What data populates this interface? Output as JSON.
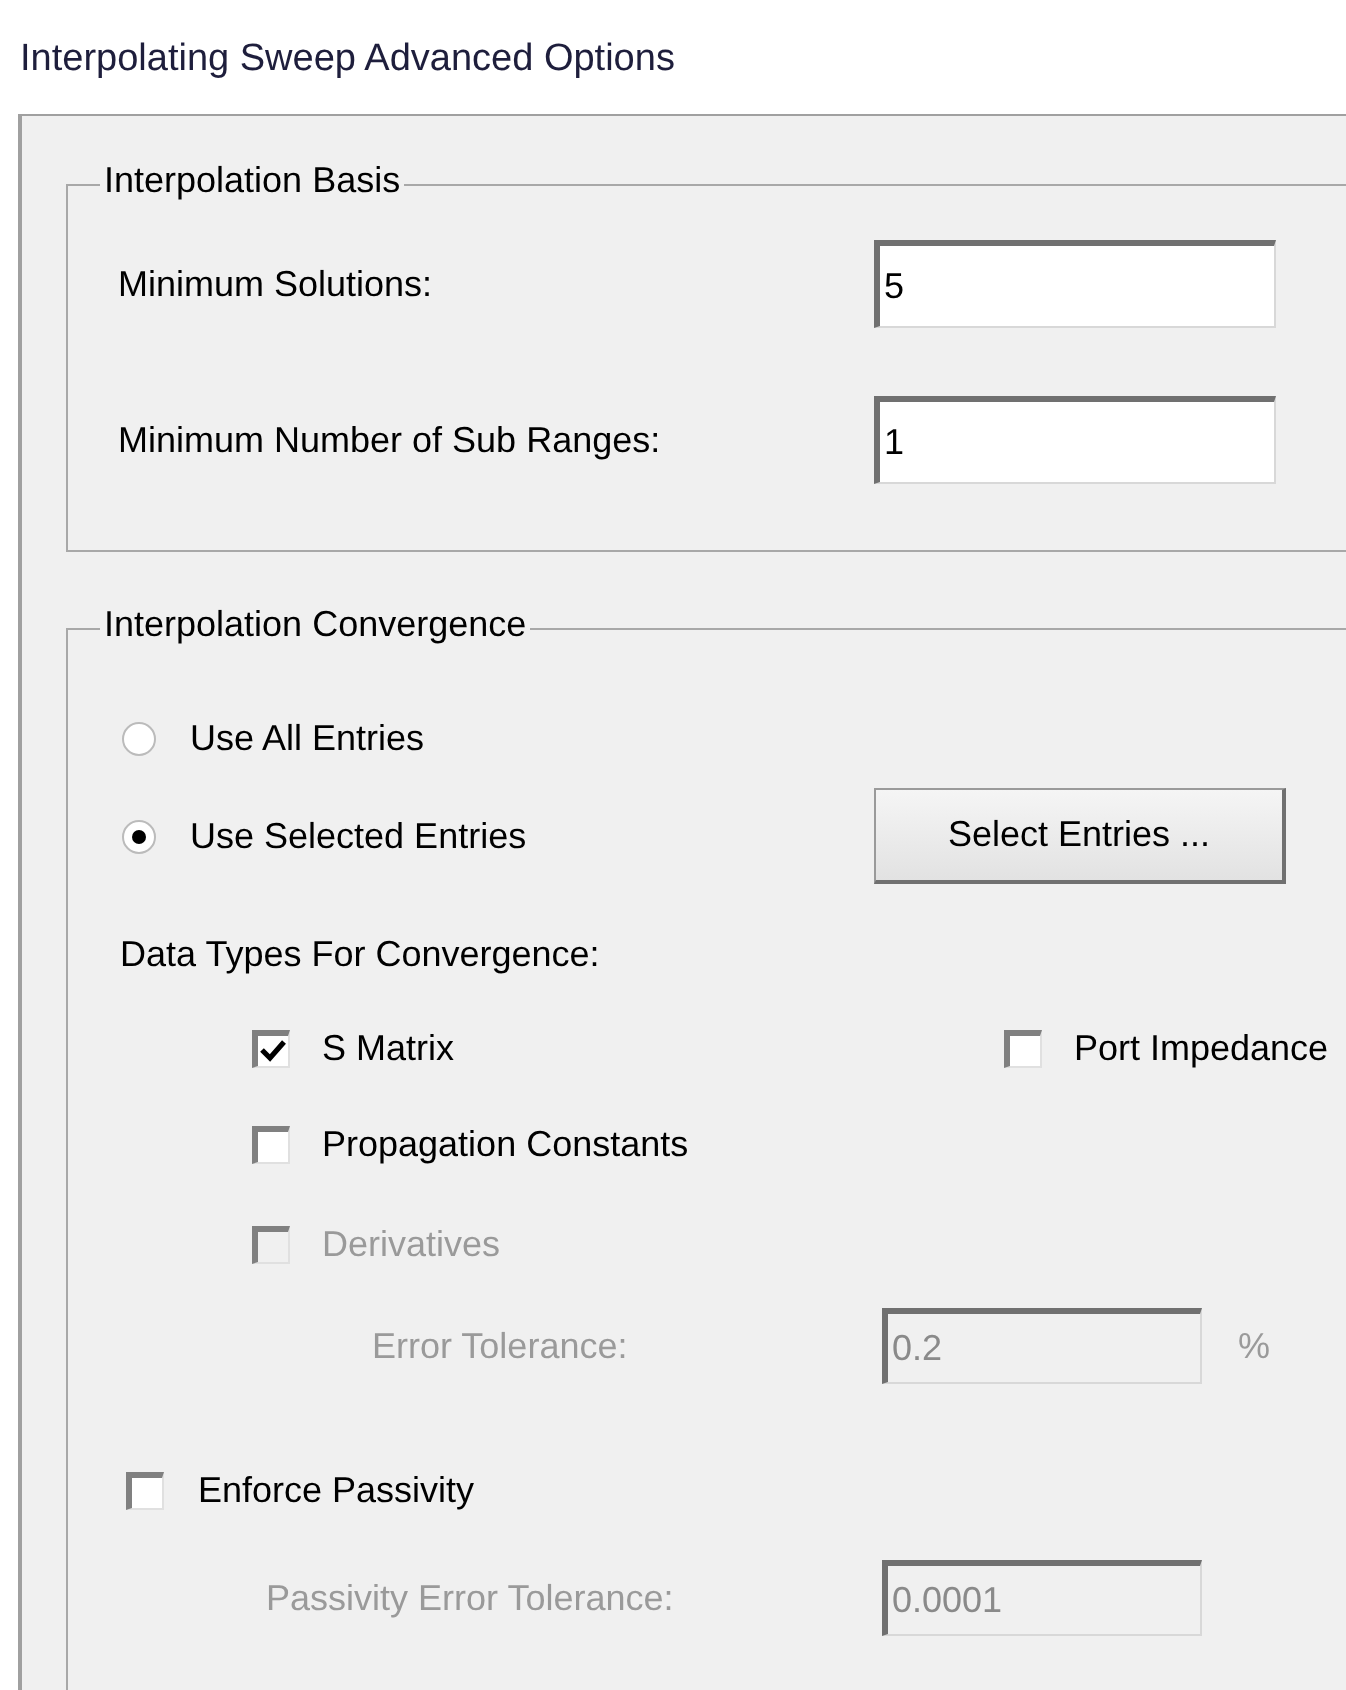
{
  "window": {
    "title": "Interpolating Sweep Advanced Options"
  },
  "interpolation_basis": {
    "title": "Interpolation Basis",
    "fields": [
      {
        "label": "Minimum Solutions:",
        "value": "5"
      },
      {
        "label": "Minimum Number of Sub Ranges:",
        "value": "1"
      }
    ]
  },
  "interpolation_convergence": {
    "title": "Interpolation Convergence",
    "entry_mode": [
      {
        "label": "Use All Entries",
        "selected": false
      },
      {
        "label": "Use Selected Entries",
        "selected": true
      }
    ],
    "select_button": "Select Entries ...",
    "data_types_label": "Data Types For Convergence:",
    "data_type_rows": [
      {
        "items": [
          {
            "label": "S Matrix",
            "checked": true,
            "disabled": false
          },
          {
            "label": "Port Impedance",
            "checked": false,
            "disabled": false
          }
        ]
      },
      {
        "items": [
          {
            "label": "Propagation Constants",
            "checked": false,
            "disabled": false
          }
        ]
      },
      {
        "items": [
          {
            "label": "Derivatives",
            "checked": false,
            "disabled": true
          }
        ]
      }
    ],
    "error_tolerance": {
      "label": "Error Tolerance:",
      "value": "0.2",
      "unit": "%",
      "disabled": true
    },
    "enforce_passivity": {
      "label": "Enforce Passivity",
      "checked": false,
      "disabled": false
    },
    "passivity_tolerance": {
      "label": "Passivity Error Tolerance:",
      "value": "0.0001",
      "disabled": true
    }
  }
}
